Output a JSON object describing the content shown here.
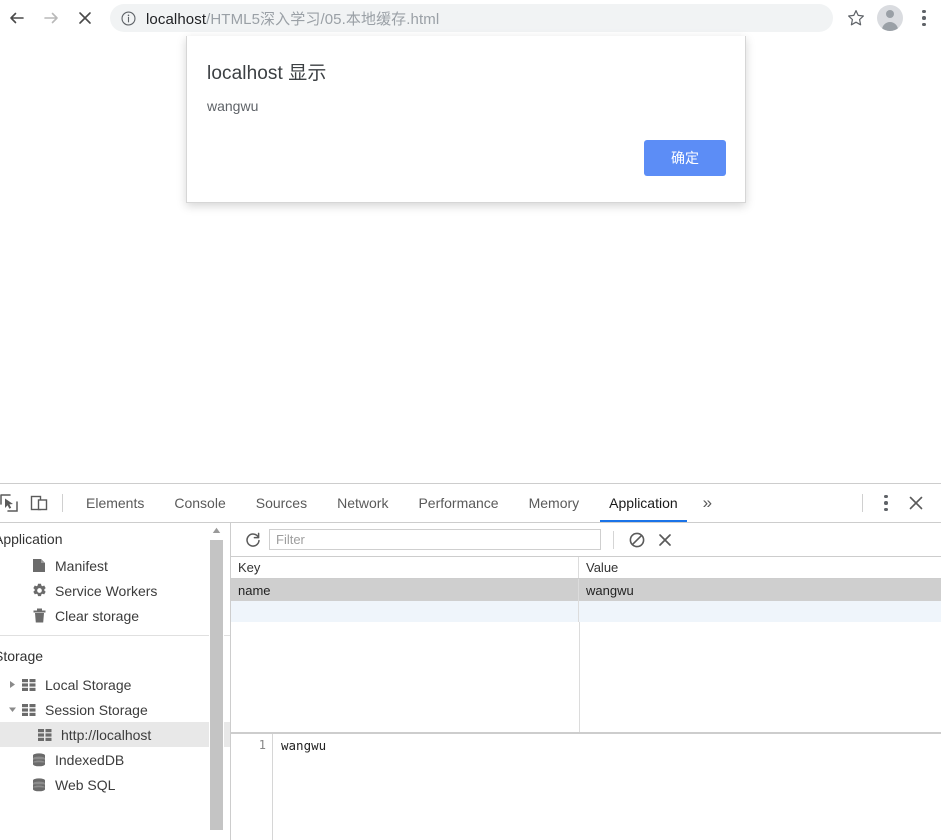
{
  "browser": {
    "nav": {
      "back_label": "Back",
      "forward_label": "Forward",
      "stop_label": "Stop"
    },
    "omnibox": {
      "info_icon": "info-circle-icon",
      "host": "localhost",
      "path": "/HTML5深入学习/05.本地缓存.html",
      "full_url": "localhost/HTML5深入学习/05.本地缓存.html"
    },
    "star_label": "Bookmark this page",
    "avatar_label": "Profile",
    "menu_label": "Customize and control Google Chrome"
  },
  "dialog": {
    "title": "localhost 显示",
    "message": "wangwu",
    "ok_label": "确定",
    "button_color": "#5c8df6"
  },
  "devtools": {
    "left_icons": [
      {
        "name": "inspect-element-icon"
      },
      {
        "name": "device-toolbar-icon"
      }
    ],
    "tabs": [
      {
        "label": "Elements",
        "active": false
      },
      {
        "label": "Console",
        "active": false
      },
      {
        "label": "Sources",
        "active": false
      },
      {
        "label": "Network",
        "active": false
      },
      {
        "label": "Performance",
        "active": false
      },
      {
        "label": "Memory",
        "active": false
      },
      {
        "label": "Application",
        "active": true
      }
    ],
    "more_tabs_label": "»",
    "active_tab_underline_color": "#1a73e8",
    "right_icons": [
      {
        "name": "more-options-icon"
      },
      {
        "name": "close-devtools-icon"
      }
    ],
    "sidebar": {
      "application_section": {
        "title": "Application",
        "items": [
          {
            "label": "Manifest",
            "icon": "document-icon"
          },
          {
            "label": "Service Workers",
            "icon": "gear-icon"
          },
          {
            "label": "Clear storage",
            "icon": "trash-icon"
          }
        ]
      },
      "storage_section": {
        "title": "Storage",
        "items": [
          {
            "label": "Local Storage",
            "icon": "table-icon",
            "expanded": false,
            "selected": false
          },
          {
            "label": "Session Storage",
            "icon": "table-icon",
            "expanded": true,
            "selected": false
          },
          {
            "label": "http://localhost",
            "icon": "table-icon",
            "nested": true,
            "selected": true
          },
          {
            "label": "IndexedDB",
            "icon": "database-icon",
            "selected": false
          },
          {
            "label": "Web SQL",
            "icon": "database-icon",
            "selected": false
          }
        ]
      }
    },
    "storage_panel": {
      "toolbar": {
        "refresh_icon": "refresh-icon",
        "filter_placeholder": "Filter",
        "filter_value": "",
        "clear_filter_icon": "clear-all-icon",
        "delete_selected_icon": "delete-selected-icon"
      },
      "table": {
        "columns": [
          "Key",
          "Value"
        ],
        "rows": [
          {
            "key": "name",
            "value": "wangwu",
            "selected": true
          },
          {
            "key": "",
            "value": "",
            "selected": false
          }
        ]
      },
      "preview": {
        "line_number": "1",
        "content": "wangwu"
      }
    }
  }
}
